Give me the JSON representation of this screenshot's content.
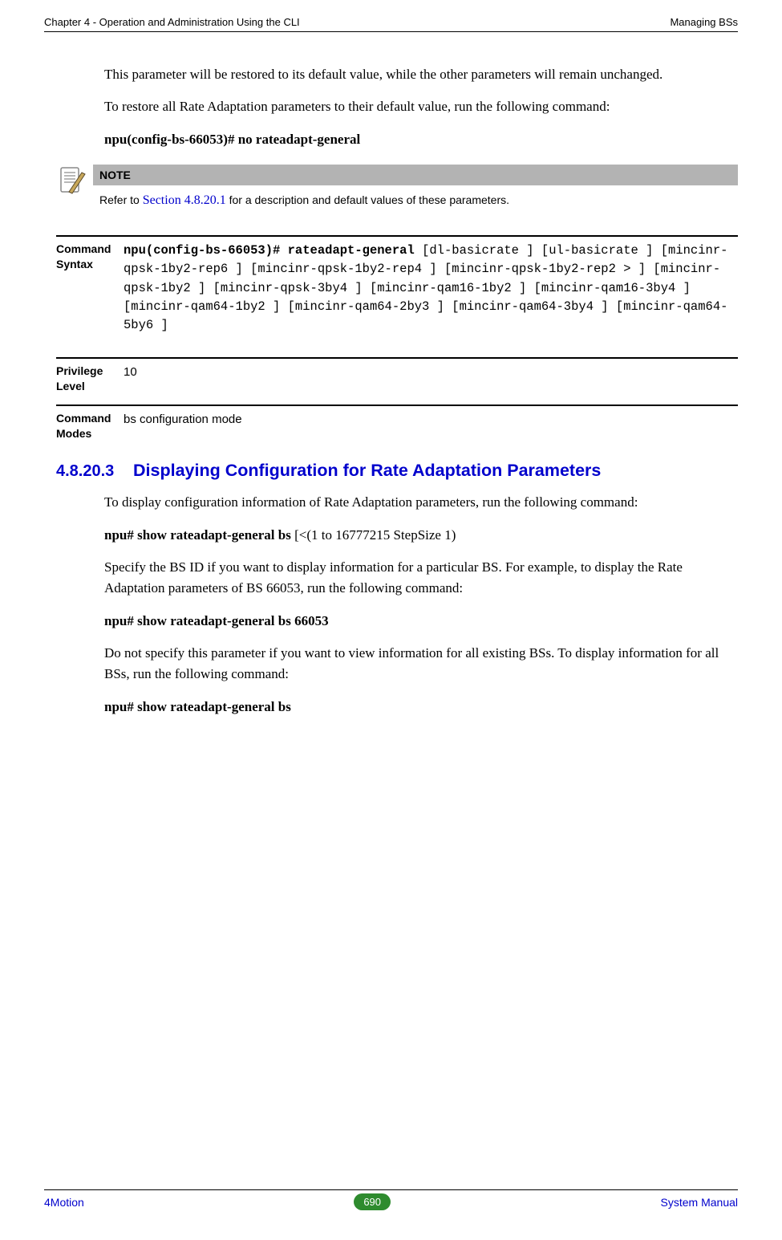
{
  "header": {
    "left": "Chapter 4 - Operation and Administration Using the CLI",
    "right": "Managing BSs"
  },
  "intro": {
    "p1": "This parameter will be restored to its default value, while the other parameters will remain unchanged.",
    "p2": "To restore all Rate Adaptation parameters to their default value, run the following command:",
    "cmd1": "npu(config-bs-66053)# no rateadapt-general"
  },
  "note": {
    "label": "NOTE",
    "body_prefix": "Refer to ",
    "body_link": "Section 4.8.20.1",
    "body_suffix": " for a description and default values of these parameters."
  },
  "params": {
    "syntax_label": "Command Syntax",
    "syntax_bold": "npu(config-bs-66053)# rateadapt-general",
    "syntax_rest": " [dl-basicrate ] [ul-basicrate ] [mincinr-qpsk-1by2-rep6 ] [mincinr-qpsk-1by2-rep4 ] [mincinr-qpsk-1by2-rep2 > ] [mincinr-qpsk-1by2 ] [mincinr-qpsk-3by4 ] [mincinr-qam16-1by2 ] [mincinr-qam16-3by4 ] [mincinr-qam64-1by2 ] [mincinr-qam64-2by3 ] [mincinr-qam64-3by4 ] [mincinr-qam64-5by6 ]",
    "priv_label": "Privilege Level",
    "priv_value": "10",
    "modes_label": "Command Modes",
    "modes_value": "bs configuration mode"
  },
  "section": {
    "num": "4.8.20.3",
    "title": "Displaying Configuration for Rate Adaptation Parameters",
    "p1": "To display configuration information of Rate Adaptation parameters, run the following command:",
    "cmd1_bold": "npu# show rateadapt-general bs",
    "cmd1_rest": " [<(1 to 16777215 StepSize 1)",
    "p2": "Specify the BS ID if you want to display information for a particular BS. For example, to display the Rate Adaptation parameters of BS 66053, run the following command:",
    "cmd2": "npu# show rateadapt-general bs 66053",
    "p3": "Do not specify this parameter if you want to view information for all existing BSs. To display information for all BSs, run the following command:",
    "cmd3": "npu# show rateadapt-general bs"
  },
  "footer": {
    "left": "4Motion",
    "page": "690",
    "right": "System Manual"
  }
}
